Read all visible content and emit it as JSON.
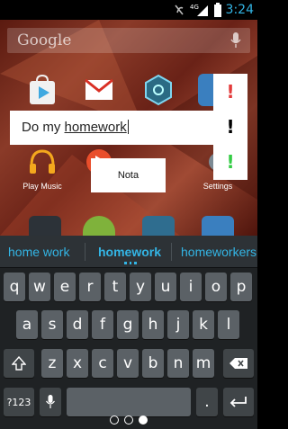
{
  "status_bar": {
    "time": "3:24",
    "network": "4G",
    "icons": [
      "notification-muted-icon",
      "signal-icon",
      "battery-icon"
    ],
    "accent": "#33b5e5"
  },
  "home": {
    "search_placeholder": "Google",
    "apps": [
      {
        "label": "",
        "icon": "play-store-icon"
      },
      {
        "label": "",
        "icon": "gmail-icon"
      },
      {
        "label": "",
        "icon": "ingress-icon"
      },
      {
        "label": "Play Music",
        "icon": "headphones-icon"
      },
      {
        "label": "",
        "icon": "play-icon"
      },
      {
        "label": "Settings",
        "icon": "settings-icon"
      }
    ]
  },
  "note_dialog": {
    "text_prefix": "Do my ",
    "text_word": "homework",
    "priorities": [
      {
        "symbol": "!",
        "color": "#e33b3b"
      },
      {
        "symbol": "!",
        "color": "#000000"
      },
      {
        "symbol": "!",
        "color": "#33cc44"
      }
    ],
    "save_label": "Nota"
  },
  "keyboard": {
    "suggestions": [
      "home work",
      "homework",
      "homeworkers"
    ],
    "row1": [
      "q",
      "w",
      "e",
      "r",
      "t",
      "y",
      "u",
      "i",
      "o",
      "p"
    ],
    "row2": [
      "a",
      "s",
      "d",
      "f",
      "g",
      "h",
      "j",
      "k",
      "l"
    ],
    "row3": [
      "z",
      "x",
      "c",
      "v",
      "b",
      "n",
      "m"
    ],
    "symbols_label": "?123",
    "period_label": "."
  },
  "nav": {
    "pages": 3,
    "active_page": 3
  }
}
